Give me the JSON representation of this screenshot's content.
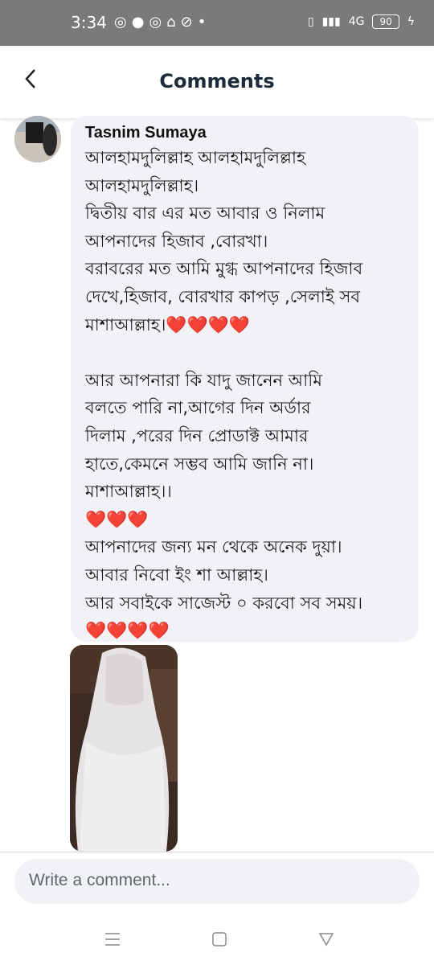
{
  "status_bar": {
    "time": "3:34",
    "left_icons": [
      "messenger-icon",
      "chat-icon",
      "messenger-icon",
      "nav-icon",
      "dnd-icon",
      "dot-icon"
    ],
    "right_icons": [
      "vibrate-icon",
      "signal-icon",
      "4g-signal-icon"
    ],
    "network": "4G",
    "battery": "90"
  },
  "header": {
    "title": "Comments",
    "back_icon": "chevron-left-icon"
  },
  "comment": {
    "author": "Tasnim Sumaya",
    "text": "আলহামদুলিল্লাহ আলহামদুলিল্লাহ\nআলহামদুলিল্লাহ।\nদ্বিতীয় বার এর মত আবার ও নিলাম\nআপনাদের হিজাব ,বোরখা।\nবরাবরের মত আমি মুগ্ধ আপনাদের হিজাব\nদেখে,হিজাব, বোরখার কাপড় ,সেলাই সব\nমাশাআল্লাহ।❤️❤️❤️❤️\n\nআর আপনারা কি যাদু জানেন আমি\nবলতে পারি না,আগের দিন অর্ডার\nদিলাম ,পরের দিন প্রোডাক্ট আমার\nহাতে,কেমনে সম্ভব আমি জানি না।\nমাশাআল্লাহ।।\n❤️❤️❤️\nআপনাদের জন্য মন থেকে অনেক দুয়া।\nআবার নিবো ইং শা আল্লাহ।\nআর সবাইকে সাজেস্ট ০ করবো সব সময়।\n❤️❤️❤️❤️"
  },
  "composer": {
    "placeholder": "Write a comment..."
  },
  "nav_bar": {
    "icons": [
      "menu-icon",
      "home-square-icon",
      "back-triangle-icon"
    ]
  },
  "colors": {
    "status_bar_bg": "#7a7a7a",
    "bubble_bg": "#f0f2f5",
    "title": "#1c2b39",
    "heart": "#e0202e"
  }
}
